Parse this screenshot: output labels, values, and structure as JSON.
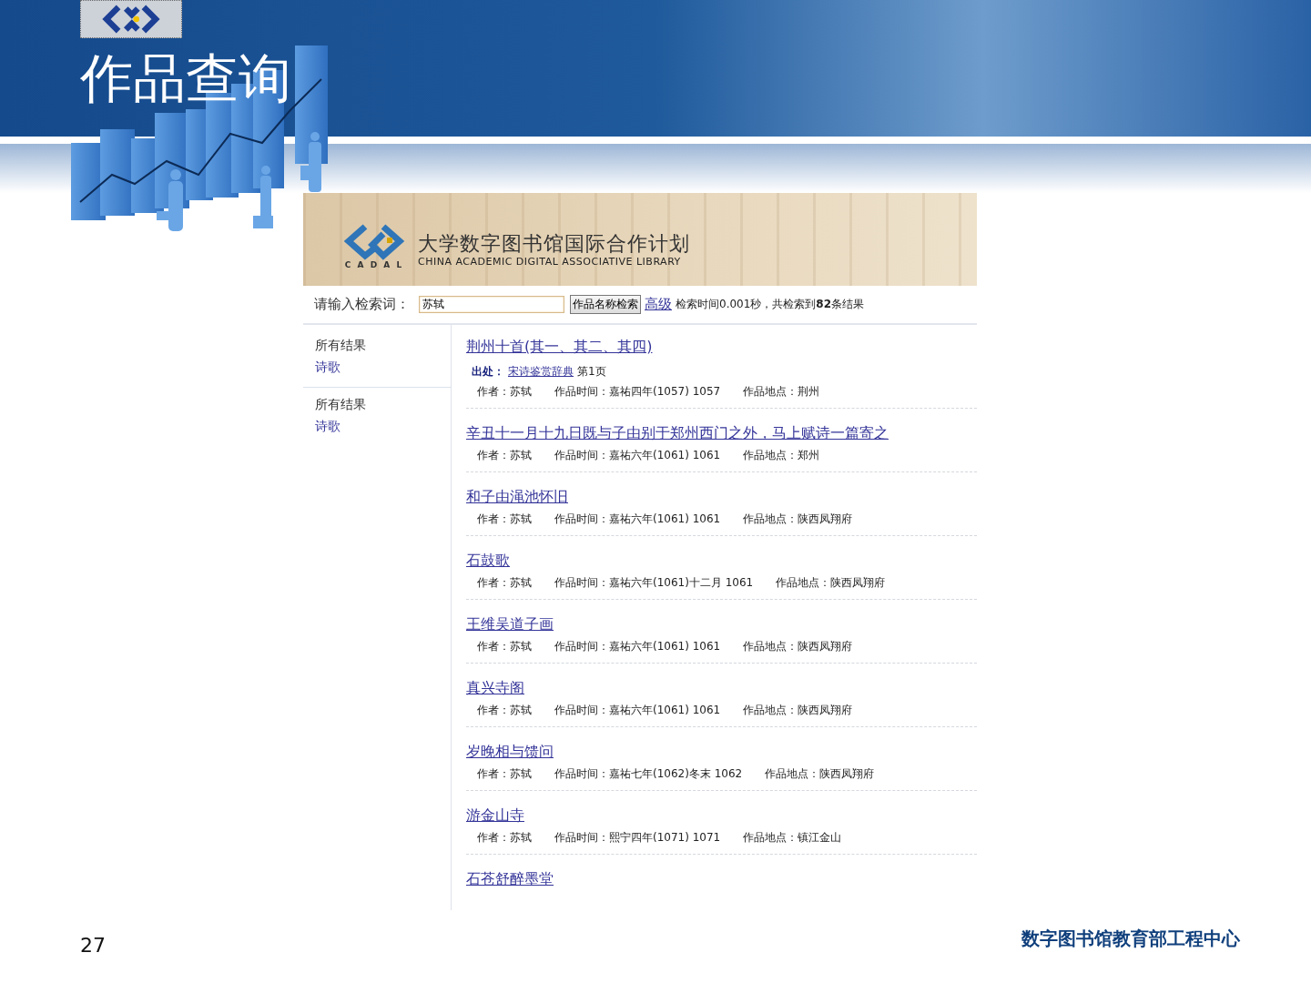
{
  "slide": {
    "title": "作品查询",
    "page_number": "27",
    "footer": "数字图书馆教育部工程中心"
  },
  "banner": {
    "logo_text": "C A D A L",
    "title": "大学数字图书馆国际合作计划",
    "subtitle": "CHINA ACADEMIC DIGITAL ASSOCIATIVE LIBRARY"
  },
  "search": {
    "label": "请输入检索词：",
    "value": "苏轼",
    "button": "作品名称检索",
    "advanced_link": "高级",
    "info": "检索时间0.001秒，共检索到**82**条结果"
  },
  "sidebar": [
    {
      "heading": "所有结果",
      "link": "诗歌"
    },
    {
      "heading": "所有结果",
      "link": "诗歌"
    }
  ],
  "results": [
    {
      "title": "荆州十首(其一、其二、其四)",
      "source": {
        "label": "出处：",
        "link": "宋诗鉴赏辞典",
        "page": "第1页"
      },
      "meta": [
        "作者：苏轼",
        "作品时间：嘉祐四年(1057) 1057",
        "作品地点：荆州"
      ]
    },
    {
      "title": "辛丑十一月十九日既与子由别于郑州西门之外，马上赋诗一篇寄之",
      "meta": [
        "作者：苏轼",
        "作品时间：嘉祐六年(1061) 1061",
        "作品地点：郑州"
      ]
    },
    {
      "title": "和子由渑池怀旧",
      "meta": [
        "作者：苏轼",
        "作品时间：嘉祐六年(1061) 1061",
        "作品地点：陕西凤翔府"
      ]
    },
    {
      "title": "石鼓歌",
      "meta": [
        "作者：苏轼",
        "作品时间：嘉祐六年(1061)十二月 1061",
        "作品地点：陕西凤翔府"
      ]
    },
    {
      "title": "王维吴道子画",
      "meta": [
        "作者：苏轼",
        "作品时间：嘉祐六年(1061) 1061",
        "作品地点：陕西凤翔府"
      ]
    },
    {
      "title": "真兴寺阁",
      "meta": [
        "作者：苏轼",
        "作品时间：嘉祐六年(1061) 1061",
        "作品地点：陕西凤翔府"
      ]
    },
    {
      "title": "岁晚相与馈问",
      "meta": [
        "作者：苏轼",
        "作品时间：嘉祐七年(1062)冬末 1062",
        "作品地点：陕西凤翔府"
      ]
    },
    {
      "title": "游金山寺",
      "meta": [
        "作者：苏轼",
        "作品时间：熙宁四年(1071) 1071",
        "作品地点：镇江金山"
      ]
    },
    {
      "title": "石苍舒醉墨堂"
    }
  ]
}
